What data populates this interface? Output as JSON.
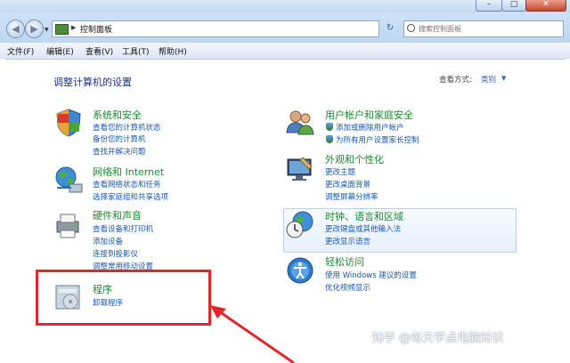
{
  "window": {
    "address": {
      "breadcrumb": "控制面板"
    },
    "search": {
      "placeholder": "搜索控制面板"
    }
  },
  "menubar": {
    "items": [
      "文件(F)",
      "编辑(E)",
      "查看(V)",
      "工具(T)",
      "帮助(H)"
    ]
  },
  "content": {
    "title": "调整计算机的设置",
    "view_by_label": "查看方式:",
    "view_by_value": "类别"
  },
  "categories": {
    "system_security": {
      "title": "系统和安全",
      "links": [
        "查看您的计算机状态",
        "备份您的计算机",
        "查找并解决问题"
      ]
    },
    "network": {
      "title": "网络和 Internet",
      "links": [
        "查看网络状态和任务",
        "选择家庭组和共享选项"
      ]
    },
    "hardware": {
      "title": "硬件和声音",
      "links": [
        "查看设备和打印机",
        "添加设备",
        "连接到投影仪",
        "调整常用移动设置"
      ]
    },
    "programs": {
      "title": "程序",
      "links": [
        "卸载程序"
      ]
    },
    "user_accounts": {
      "title": "用户帐户和家庭安全",
      "links": [
        "添加或删除用户帐户",
        "为所有用户设置家长控制"
      ]
    },
    "appearance": {
      "title": "外观和个性化",
      "links": [
        "更改主题",
        "更改桌面背景",
        "调整屏幕分辨率"
      ]
    },
    "clock": {
      "title": "时钟、语言和区域",
      "links": [
        "更改键盘或其他输入法",
        "更改显示语言"
      ]
    },
    "ease": {
      "title": "轻松访问",
      "links": [
        "使用 Windows 建议的设置",
        "优化视频显示"
      ]
    }
  },
  "watermark": "知乎 @每天学点电脑知识",
  "colors": {
    "title_green": "#1a8a2f",
    "link_blue": "#1559b8",
    "highlight_red": "#e0282c"
  }
}
